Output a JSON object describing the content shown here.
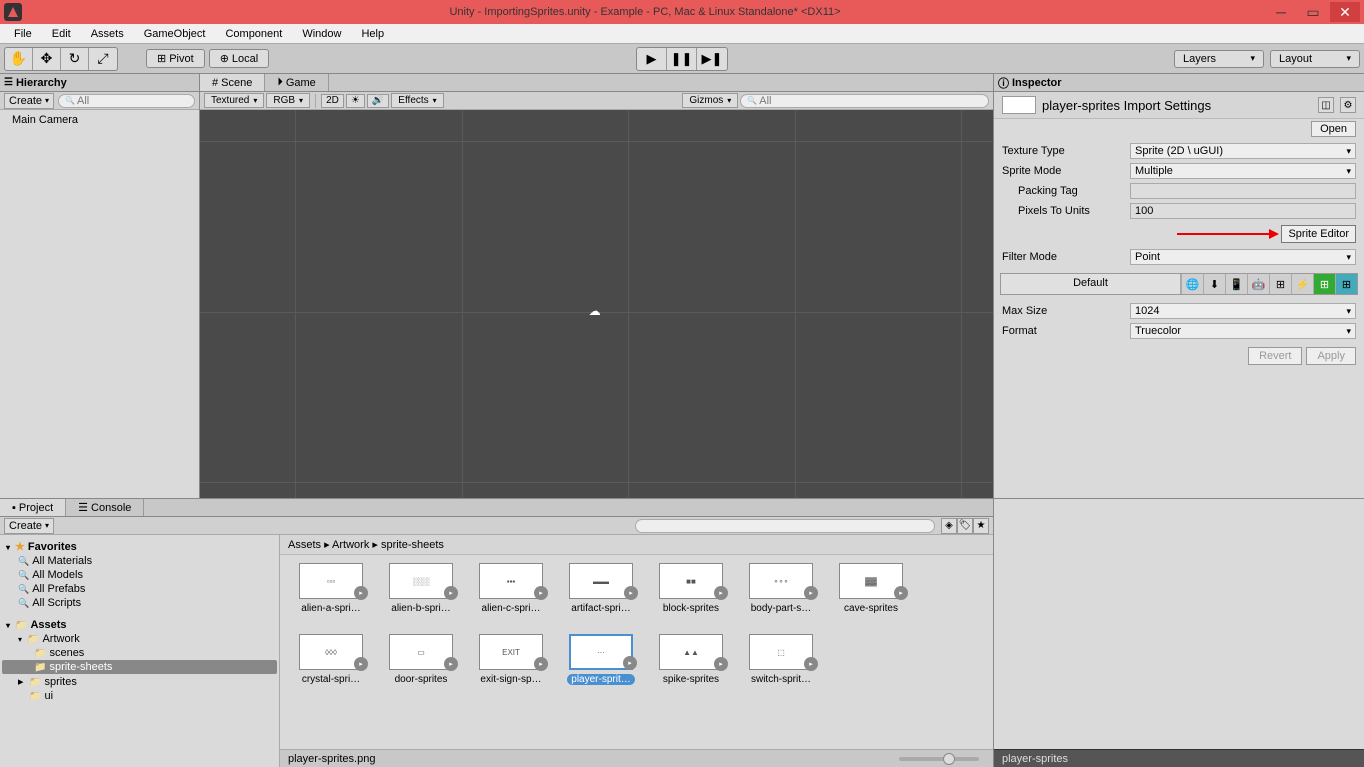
{
  "title": "Unity - ImportingSprites.unity - Example - PC, Mac & Linux Standalone* <DX11>",
  "menu": [
    "File",
    "Edit",
    "Assets",
    "GameObject",
    "Component",
    "Window",
    "Help"
  ],
  "toolbar": {
    "pivot": "Pivot",
    "local": "Local",
    "layers": "Layers",
    "layout": "Layout"
  },
  "hierarchy": {
    "title": "Hierarchy",
    "create": "Create",
    "search_placeholder": "All",
    "items": [
      "Main Camera"
    ]
  },
  "scene": {
    "tabs": [
      "Scene",
      "Game"
    ],
    "shading": "Textured",
    "rgb": "RGB",
    "mode2d": "2D",
    "effects": "Effects",
    "gizmos": "Gizmos",
    "search": "All"
  },
  "inspector": {
    "title": "Inspector",
    "asset_name": "player-sprites Import Settings",
    "open": "Open",
    "texture_type": {
      "label": "Texture Type",
      "value": "Sprite (2D \\ uGUI)"
    },
    "sprite_mode": {
      "label": "Sprite Mode",
      "value": "Multiple"
    },
    "packing_tag": {
      "label": "Packing Tag",
      "value": ""
    },
    "pixels_to_units": {
      "label": "Pixels To Units",
      "value": "100"
    },
    "sprite_editor": "Sprite Editor",
    "filter_mode": {
      "label": "Filter Mode",
      "value": "Point"
    },
    "default": "Default",
    "max_size": {
      "label": "Max Size",
      "value": "1024"
    },
    "format": {
      "label": "Format",
      "value": "Truecolor"
    },
    "revert": "Revert",
    "apply": "Apply"
  },
  "project": {
    "tabs": [
      "Project",
      "Console"
    ],
    "create": "Create",
    "favorites": "Favorites",
    "fav_items": [
      "All Materials",
      "All Models",
      "All Prefabs",
      "All Scripts"
    ],
    "assets": "Assets",
    "tree": [
      "Artwork",
      "scenes",
      "sprite-sheets",
      "sprites",
      "ui"
    ],
    "breadcrumb": "Assets ▸ Artwork ▸ sprite-sheets",
    "sprites": [
      {
        "name": "alien-a-spri…"
      },
      {
        "name": "alien-b-spri…"
      },
      {
        "name": "alien-c-spri…"
      },
      {
        "name": "artifact-spri…"
      },
      {
        "name": "block-sprites"
      },
      {
        "name": "body-part-s…"
      },
      {
        "name": "cave-sprites"
      },
      {
        "name": "crystal-spri…"
      },
      {
        "name": "door-sprites"
      },
      {
        "name": "exit-sign-sp…"
      },
      {
        "name": "player-sprit…",
        "selected": true
      },
      {
        "name": "spike-sprites"
      },
      {
        "name": "switch-sprit…"
      }
    ],
    "status": "player-sprites.png",
    "selected_footer": "player-sprites"
  }
}
